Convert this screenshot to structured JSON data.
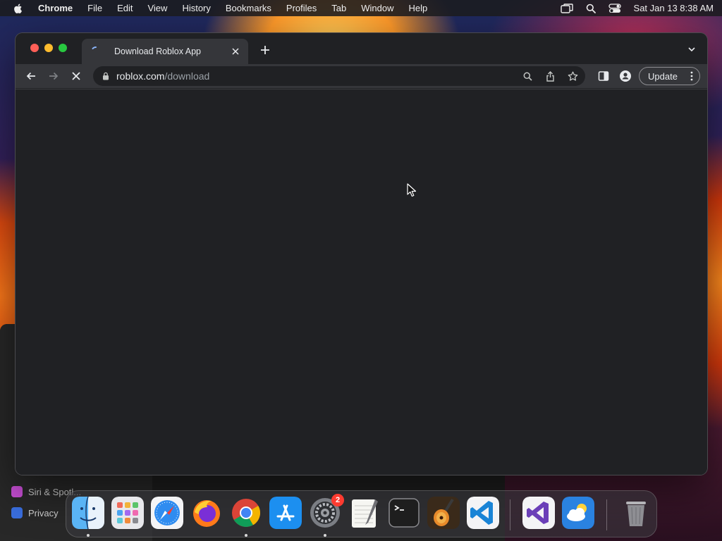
{
  "menubar": {
    "apple_icon": "apple-logo-icon",
    "items": [
      "Chrome",
      "File",
      "Edit",
      "View",
      "History",
      "Bookmarks",
      "Profiles",
      "Tab",
      "Window",
      "Help"
    ],
    "status_icons": [
      "screen-mirroring-icon",
      "spotlight-search-icon",
      "control-center-icon"
    ],
    "datetime": "Sat Jan 13  8:38 AM"
  },
  "behind_window": {
    "items": [
      {
        "label": "Siri & Spotl...",
        "icon": "siri-icon",
        "color": "#c94fd6"
      },
      {
        "label": "Privacy",
        "icon": "privacy-hand-icon",
        "color": "#3a6fe0"
      }
    ]
  },
  "browser": {
    "tab": {
      "title": "Download Roblox App",
      "loading": true
    },
    "omnibox": {
      "host": "roblox.com",
      "path": "/download"
    },
    "update_label": "Update"
  },
  "dock": {
    "apps": [
      {
        "name": "Finder",
        "icon": "finder-icon",
        "running": true
      },
      {
        "name": "Launchpad",
        "icon": "launchpad-icon",
        "running": false
      },
      {
        "name": "Safari",
        "icon": "safari-icon",
        "running": false
      },
      {
        "name": "Firefox",
        "icon": "firefox-icon",
        "running": false
      },
      {
        "name": "Google Chrome",
        "icon": "chrome-icon",
        "running": true
      },
      {
        "name": "App Store",
        "icon": "app-store-icon",
        "running": false
      },
      {
        "name": "System Settings",
        "icon": "system-settings-icon",
        "running": true,
        "badge": "2"
      },
      {
        "name": "TextEdit",
        "icon": "textedit-icon",
        "running": false
      },
      {
        "name": "Terminal",
        "icon": "terminal-icon",
        "running": false
      },
      {
        "name": "GarageBand",
        "icon": "garageband-icon",
        "running": false
      },
      {
        "name": "Visual Studio Code",
        "icon": "vscode-icon",
        "running": false
      },
      {
        "name": "Visual Studio",
        "icon": "visual-studio-icon",
        "running": false
      },
      {
        "name": "Weather",
        "icon": "weather-icon",
        "running": false
      },
      {
        "name": "Trash",
        "icon": "trash-icon",
        "running": false
      }
    ],
    "badge_system_settings": "2"
  },
  "colors": {
    "window_bg": "#202124",
    "toolbar_bg": "#35363a",
    "tab_active_bg": "#35363a"
  }
}
